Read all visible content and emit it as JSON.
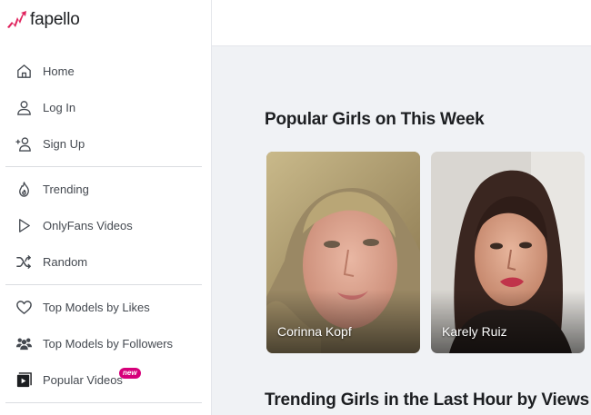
{
  "brand": {
    "name": "fapello",
    "accent": "#e0245e"
  },
  "nav": {
    "group1": [
      {
        "label": "Home",
        "icon": "home-icon"
      },
      {
        "label": "Log In",
        "icon": "user-icon"
      },
      {
        "label": "Sign Up",
        "icon": "user-plus-icon"
      }
    ],
    "group2": [
      {
        "label": "Trending",
        "icon": "flame-icon"
      },
      {
        "label": "OnlyFans Videos",
        "icon": "play-icon"
      },
      {
        "label": "Random",
        "icon": "shuffle-icon"
      }
    ],
    "group3": [
      {
        "label": "Top Models by Likes",
        "icon": "heart-icon"
      },
      {
        "label": "Top Models by Followers",
        "icon": "users-icon"
      },
      {
        "label": "Popular Videos",
        "icon": "video-icon",
        "badge": "new"
      }
    ]
  },
  "main": {
    "popular_title": "Popular Girls on This Week",
    "trending_title": "Trending Girls in the Last Hour by Views",
    "models": [
      {
        "name": "Corinna Kopf"
      },
      {
        "name": "Karely Ruiz"
      }
    ]
  }
}
